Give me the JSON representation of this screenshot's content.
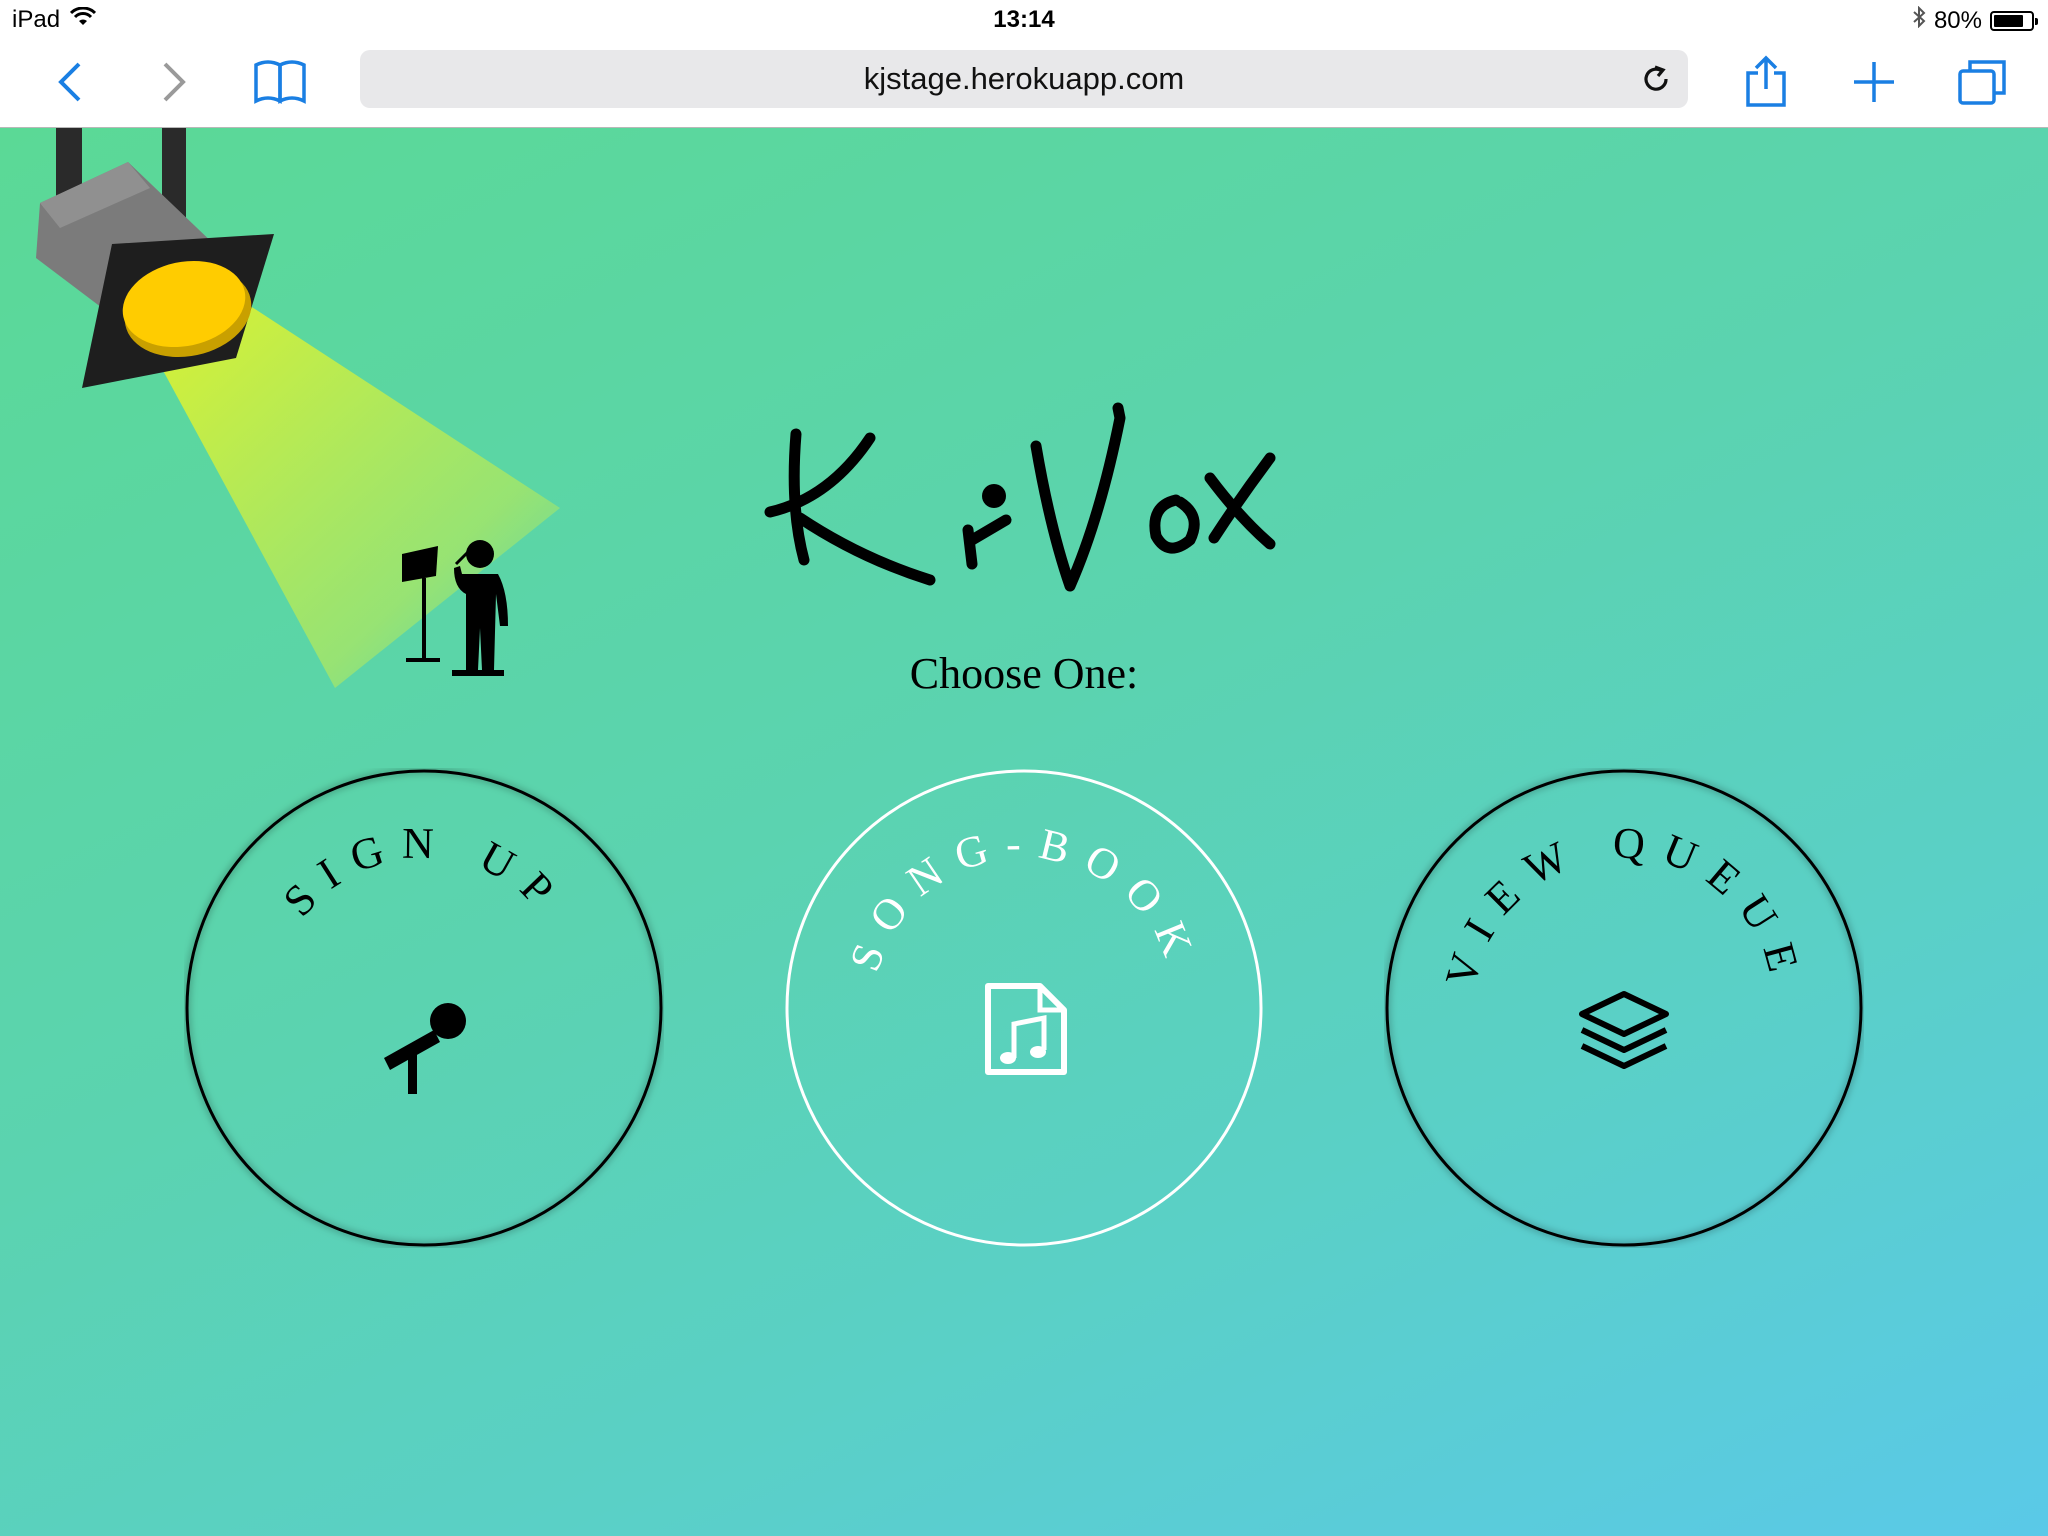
{
  "status_bar": {
    "device": "iPad",
    "time": "13:14",
    "battery_percent": "80%",
    "battery_level": 0.8
  },
  "toolbar": {
    "url": "kjstage.herokuapp.com",
    "accent_color": "#1a7fe3"
  },
  "page": {
    "logo_text": "K-Vox",
    "choose_label": "Choose One:",
    "buttons": [
      {
        "label": "SIGN UP",
        "icon": "microphone-icon",
        "color": "#000000"
      },
      {
        "label": "SONG-BOOK",
        "icon": "music-file-icon",
        "color": "#ffffff"
      },
      {
        "label": "VIEW QUEUE",
        "icon": "layers-icon",
        "color": "#000000"
      }
    ]
  },
  "colors": {
    "gradient_start": "#5bd996",
    "gradient_end": "#5ac9e8",
    "spot_yellow": "#ffcc00",
    "beam_yellow": "#dcf230"
  }
}
